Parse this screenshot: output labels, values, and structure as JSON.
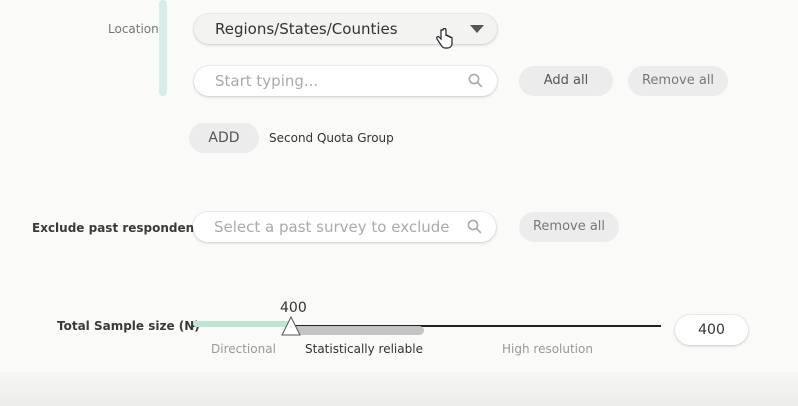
{
  "location": {
    "label": "Location",
    "dropdown_value": "Regions/States/Counties",
    "search_placeholder": "Start typing...",
    "add_all_label": "Add all",
    "remove_all_label": "Remove all"
  },
  "quota": {
    "add_label": "ADD",
    "group_label": "Second Quota Group"
  },
  "exclude": {
    "label": "Exclude past respondents",
    "search_placeholder": "Select a past survey to exclude",
    "remove_all_label": "Remove all"
  },
  "sample": {
    "label": "Total Sample size (N)",
    "slider_value": "400",
    "input_value": "400",
    "zones": [
      "Directional",
      "Statistically reliable",
      "High resolution"
    ]
  },
  "colors": {
    "accent": "#d6ede9",
    "slider_fill": "#bfe5d2",
    "slider_mid": "#c4c4c4",
    "slider_track": "#222222"
  }
}
